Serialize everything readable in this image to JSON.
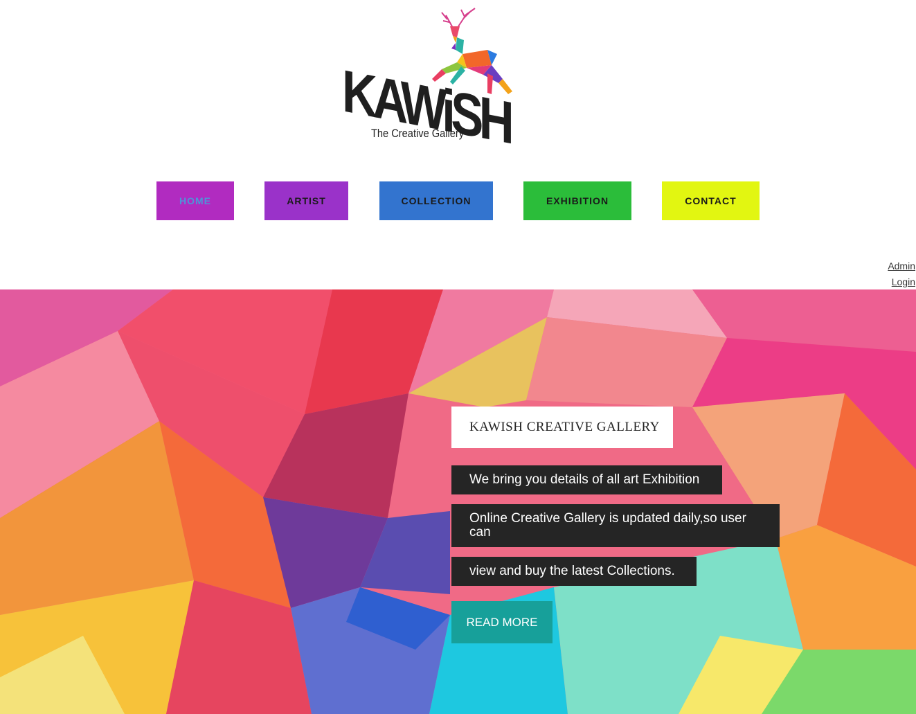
{
  "logo": {
    "wordmark": "KAWiSH",
    "tagline": "The Creative Gallery"
  },
  "nav": {
    "items": [
      {
        "label": "HOME",
        "color": "#b12bc0"
      },
      {
        "label": "ARTIST",
        "color": "#9a32c9"
      },
      {
        "label": "COLLECTION",
        "color": "#3374cf"
      },
      {
        "label": "EXHIBITION",
        "color": "#2bbd3a"
      },
      {
        "label": "CONTACT",
        "color": "#e2f611"
      }
    ]
  },
  "admin": {
    "line1": "Admin",
    "line2": "Login"
  },
  "hero": {
    "title": "KAWISH CREATIVE GALLERY",
    "lines": [
      "We bring you details of all art Exhibition",
      "Online Creative Gallery is updated daily,so user can",
      "view and buy the latest Collections."
    ],
    "cta": "READ MORE",
    "accent": "#17a09a"
  }
}
